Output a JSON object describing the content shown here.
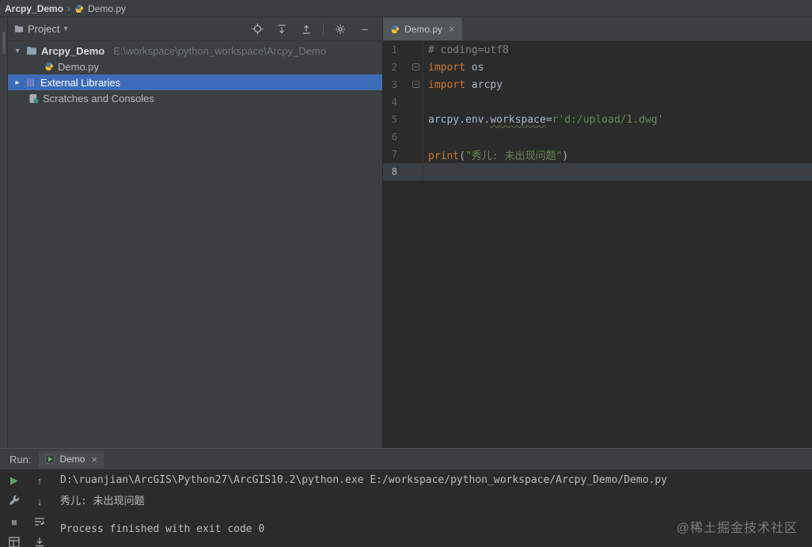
{
  "breadcrumb": {
    "project": "Arcpy_Demo",
    "separator": "›",
    "file": "Demo.py"
  },
  "icons": {
    "chevron_down": "▾",
    "chevron_right": "▸",
    "close": "×",
    "minus": "−",
    "play": "▶",
    "stop": "■",
    "arrow_up": "↑",
    "arrow_down": "↓"
  },
  "project_panel": {
    "title": "Project",
    "tree": {
      "root": {
        "label": "Arcpy_Demo",
        "path": "E:\\workspace\\python_workspace\\Arcpy_Demo"
      },
      "file": {
        "label": "Demo.py"
      },
      "external": {
        "label": "External Libraries"
      },
      "scratches": {
        "label": "Scratches and Consoles"
      }
    }
  },
  "editor": {
    "tab": {
      "label": "Demo.py"
    },
    "lines": [
      {
        "num": "1",
        "segments": [
          {
            "text": "# coding=utf8",
            "style": "comment"
          }
        ]
      },
      {
        "num": "2",
        "fold": true,
        "segments": [
          {
            "text": "import",
            "style": "keyword"
          },
          {
            "text": " os",
            "style": "plain"
          }
        ]
      },
      {
        "num": "3",
        "fold": true,
        "segments": [
          {
            "text": "import",
            "style": "keyword"
          },
          {
            "text": " arcpy",
            "style": "plain"
          }
        ]
      },
      {
        "num": "4",
        "segments": []
      },
      {
        "num": "5",
        "segments": [
          {
            "text": "arcpy.env.",
            "style": "plain"
          },
          {
            "text": "workspace",
            "style": "plain",
            "underline": true
          },
          {
            "text": "=",
            "style": "plain"
          },
          {
            "text": "r'd:/upload/1.dwg'",
            "style": "string"
          }
        ]
      },
      {
        "num": "6",
        "segments": []
      },
      {
        "num": "7",
        "segments": [
          {
            "text": "print",
            "style": "keyword"
          },
          {
            "text": "(",
            "style": "plain"
          },
          {
            "text": "\"秀儿: 未出现问题\"",
            "style": "string"
          },
          {
            "text": ")",
            "style": "plain"
          }
        ]
      },
      {
        "num": "8",
        "current": true,
        "segments": []
      }
    ]
  },
  "run_panel": {
    "label": "Run:",
    "tab": {
      "label": "Demo"
    },
    "console": [
      "D:\\ruanjian\\ArcGIS\\Python27\\ArcGIS10.2\\python.exe E:/workspace/python_workspace/Arcpy_Demo/Demo.py",
      "秀儿: 未出现问题",
      "Process finished with exit code 0"
    ]
  },
  "watermark": "@稀土掘金技术社区",
  "colors": {
    "panel_bg": "#3c3f41",
    "editor_bg": "#2b2b2b",
    "selection_blue": "#3c6cb8",
    "current_line": "#3b3e40",
    "keyword": "#cc7832",
    "string": "#6a8759",
    "comment": "#808080",
    "plain_code": "#a9b7c6",
    "line_number": "#606366",
    "run_green": "#5ba75b"
  }
}
